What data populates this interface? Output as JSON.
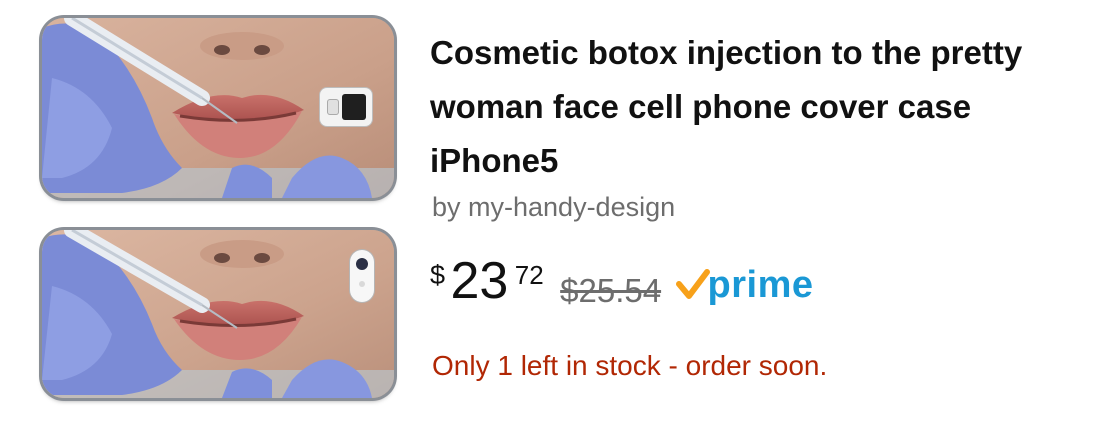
{
  "product": {
    "title": "Cosmetic botox injection to the pretty woman face cell phone cover case iPhone5",
    "byline": "by my-handy-design",
    "price": {
      "currency": "$",
      "whole": "23",
      "fraction": "72",
      "list_price": "$25.54"
    },
    "prime_label": "prime",
    "stock_message": "Only 1 left in stock - order soon."
  },
  "images": [
    {
      "name": "case-front-camera-rect",
      "icon": "camera-rect-icon"
    },
    {
      "name": "case-back-camera-pill",
      "icon": "camera-pill-icon"
    }
  ],
  "colors": {
    "title": "#111111",
    "byline": "#6d6d6d",
    "stock": "#b12704",
    "prime_blue": "#1a98d5",
    "prime_check": "#f7a11a"
  }
}
